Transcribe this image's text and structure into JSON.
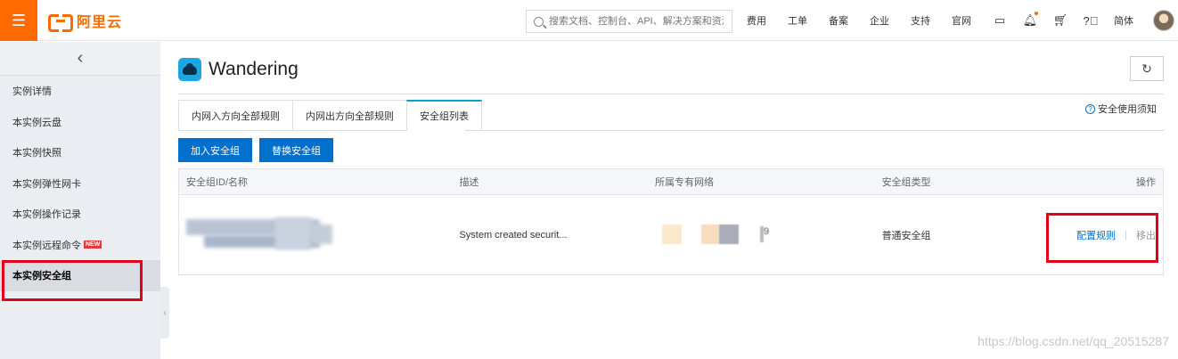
{
  "topbar": {
    "menu_icon": "hamburger-icon",
    "logo_text": "阿里云",
    "search_placeholder": "搜索文档、控制台、API、解决方案和资源",
    "nav": [
      "费用",
      "工单",
      "备案",
      "企业",
      "支持",
      "官网"
    ],
    "lang": "简体",
    "icons": [
      "terminal-icon",
      "bell-icon",
      "cart-icon",
      "help-icon"
    ]
  },
  "sidebar": {
    "back_icon": "chevron-left-icon",
    "items": [
      {
        "label": "实例详情"
      },
      {
        "label": "本实例云盘"
      },
      {
        "label": "本实例快照"
      },
      {
        "label": "本实例弹性网卡"
      },
      {
        "label": "本实例操作记录"
      },
      {
        "label": "本实例远程命令",
        "badge": "NEW"
      },
      {
        "label": "本实例安全组",
        "active": true
      }
    ]
  },
  "main": {
    "title": "Wandering",
    "refresh_icon": "refresh-icon",
    "tabs": [
      {
        "label": "内网入方向全部规则"
      },
      {
        "label": "内网出方向全部规则"
      },
      {
        "label": "安全组列表",
        "active": true
      }
    ],
    "notice": "安全使用须知",
    "buttons": {
      "join": "加入安全组",
      "replace": "替换安全组"
    },
    "table": {
      "headers": [
        "安全组ID/名称",
        "描述",
        "所属专有网络",
        "安全组类型",
        "操作"
      ],
      "rows": [
        {
          "description": "System created securit...",
          "vpc_suffix": "9",
          "type": "普通安全组",
          "op_config": "配置规则",
          "op_remove": "移出"
        }
      ]
    }
  },
  "watermark": "https://blog.csdn.net/qq_20515287",
  "colors": {
    "brand": "#ff6a00",
    "primary": "#0070cc",
    "highlight": "#e0001b"
  }
}
